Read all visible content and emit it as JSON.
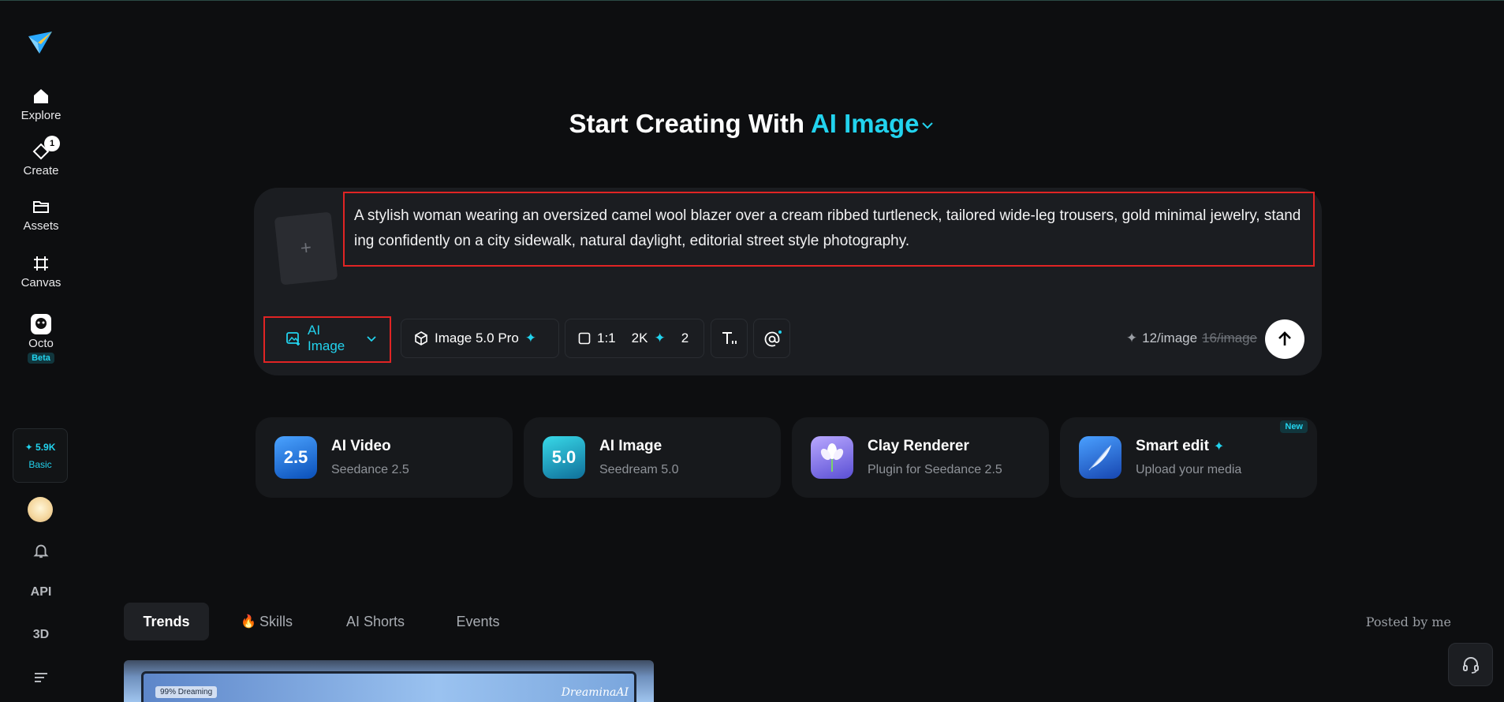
{
  "sidebar": {
    "nav": [
      {
        "label": "Explore",
        "icon": "home-icon"
      },
      {
        "label": "Create",
        "icon": "create-icon",
        "badge": "1"
      },
      {
        "label": "Assets",
        "icon": "folder-icon"
      },
      {
        "label": "Canvas",
        "icon": "canvas-icon"
      },
      {
        "label": "Octo",
        "icon": "octo-icon",
        "tag": "Beta"
      }
    ],
    "credits": {
      "amount": "5.9K",
      "plan": "Basic"
    },
    "api_label": "API",
    "threed_label": "3D"
  },
  "hero": {
    "title_prefix": "Start Creating With",
    "title_accent": "AI Image"
  },
  "prompt": {
    "text": "A stylish woman wearing an oversized camel wool blazer over a cream ribbed turtleneck, tailored wide-leg trousers, gold minimal jewelry, standing confidently on a city sidewalk, natural daylight, editorial street style photography.",
    "upload_glyph": "+"
  },
  "toolbar": {
    "mode_label": "AI Image",
    "model_label": "Image 5.0 Pro",
    "ratio_label": "1:1",
    "resolution_label": "2K",
    "count_label": "2",
    "cost_label": "12/image",
    "cost_original": "16/image"
  },
  "cards": [
    {
      "title": "AI Video",
      "subtitle": "Seedance 2.5",
      "icon_text": "2.5",
      "icon": "ai-video-icon"
    },
    {
      "title": "AI Image",
      "subtitle": "Seedream 5.0",
      "icon_text": "5.0",
      "icon": "ai-image-icon"
    },
    {
      "title": "Clay Renderer",
      "subtitle": "Plugin for Seedance 2.5",
      "icon": "flower-icon"
    },
    {
      "title": "Smart edit",
      "subtitle": "Upload your media",
      "icon": "feather-icon",
      "badge": "New"
    }
  ],
  "tabs": [
    {
      "label": "Trends"
    },
    {
      "label": "Skills",
      "emoji": "🔥"
    },
    {
      "label": "AI Shorts"
    },
    {
      "label": "Events"
    }
  ],
  "posted_by": "Posted by me",
  "preview": {
    "tag": "99% Dreaming",
    "brand": "DreaminaAI"
  },
  "colors": {
    "accent": "#22d3ee",
    "background": "#0d0e10",
    "panel": "#1b1d21",
    "highlight": "#e02424"
  }
}
